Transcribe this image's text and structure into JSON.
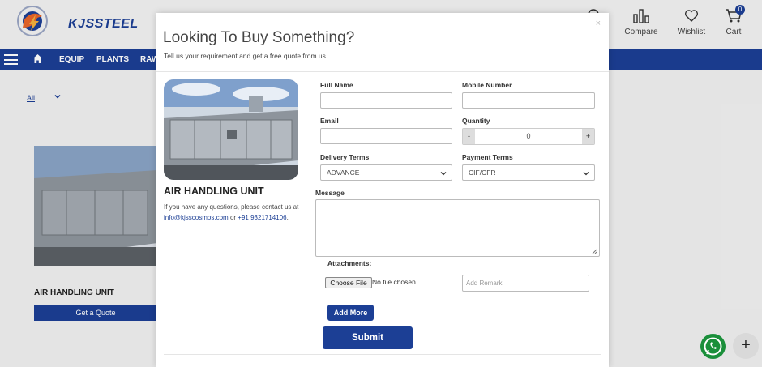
{
  "brand": {
    "name": "KJSSTEEL"
  },
  "header": {
    "compare_label": "Compare",
    "wishlist_label": "Wishlist",
    "cart_label": "Cart",
    "cart_count": "0"
  },
  "nav": {
    "items": [
      "EQUIP",
      "PLANTS",
      "RAW"
    ]
  },
  "filter": {
    "selected": "All"
  },
  "background_product": {
    "title": "AIR HANDLING UNIT",
    "button_label": "Get a Quote"
  },
  "modal": {
    "title": "Looking To Buy Something?",
    "subtitle": "Tell us your requirement and get a free quote from us",
    "close_label": "×",
    "product": {
      "title": "AIR HANDLING UNIT",
      "info_prefix": "If you have any questions, please contact us at",
      "email": "info@kjsscosmos.com",
      "info_or": "or",
      "phone": "+91 9321714106",
      "info_suffix": "."
    },
    "form": {
      "full_name_label": "Full Name",
      "full_name_value": "",
      "mobile_label": "Mobile Number",
      "mobile_value": "",
      "email_label": "Email",
      "email_value": "",
      "quantity_label": "Quantity",
      "quantity_minus": "-",
      "quantity_value": "0",
      "quantity_plus": "+",
      "delivery_label": "Delivery Terms",
      "delivery_value": "ADVANCE",
      "payment_label": "Payment Terms",
      "payment_value": "CIF/CFR",
      "message_label": "Message",
      "attachments_label": "Attachments:",
      "choose_file_label": "Choose File",
      "no_file_text": "No file chosen",
      "remark_placeholder": "Add Remark",
      "add_more_label": "Add More",
      "submit_label": "Submit"
    }
  },
  "fab": {
    "plus_label": "+"
  },
  "colors": {
    "brand_blue": "#1c3f95",
    "whatsapp_green": "#1a8f3a",
    "logo_orange": "#e8652a"
  }
}
